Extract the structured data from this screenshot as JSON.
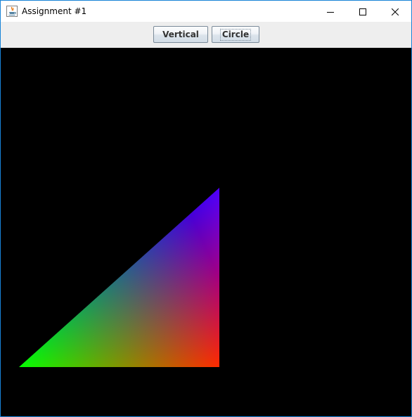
{
  "window": {
    "title": "Assignment #1",
    "app_icon": "java-icon",
    "controls": {
      "minimize_icon": "minimize-icon",
      "maximize_icon": "maximize-icon",
      "close_icon": "close-icon"
    }
  },
  "toolbar": {
    "vertical_label": "Vertical",
    "circle_label": "Circle"
  },
  "canvas": {
    "background": "#000000",
    "shape": "triangle",
    "vertex_colors": {
      "bottom_left": "#00ff00",
      "bottom_right": "#ff0000",
      "top_right": "#0000ff"
    }
  },
  "colors": {
    "window_border": "#1883d7",
    "toolbar_background": "#eeeeee"
  }
}
